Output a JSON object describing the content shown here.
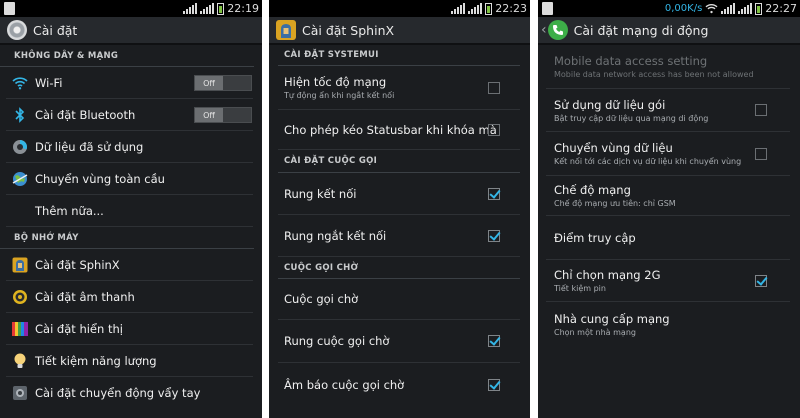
{
  "colors": {
    "accent": "#33b5e5",
    "background": "#1b1d20",
    "battery": "#7fc241"
  },
  "panel1": {
    "status": {
      "time": "22:19"
    },
    "title": "Cài đặt",
    "title_icon": "settings-gear-icon",
    "sections": [
      {
        "header": "KHÔNG DÂY & MẠNG"
      },
      {
        "header": "BỘ NHỚ MÁY"
      }
    ],
    "rows": [
      {
        "label": "Wi-Fi",
        "icon": "wifi-icon",
        "toggle": "Off"
      },
      {
        "label": "Cài đặt Bluetooth",
        "icon": "bluetooth-icon",
        "toggle": "Off"
      },
      {
        "label": "Dữ liệu đã sử dụng",
        "icon": "data-usage-icon"
      },
      {
        "label": "Chuyển vùng toàn cầu",
        "icon": "globe-icon"
      },
      {
        "label": "Thêm nữa..."
      },
      {
        "label": "Cài đặt SphinX",
        "icon": "sphinx-icon"
      },
      {
        "label": "Cài đặt âm thanh",
        "icon": "sound-icon"
      },
      {
        "label": "Cài đặt hiển thị",
        "icon": "display-icon"
      },
      {
        "label": "Tiết kiệm năng lượng",
        "icon": "power-saving-icon"
      },
      {
        "label": "Cài đặt chuyển động vẩy tay",
        "icon": "gesture-icon"
      }
    ]
  },
  "panel2": {
    "status": {
      "time": "22:23"
    },
    "title": "Cài đặt SphinX",
    "title_icon": "sphinx-icon",
    "sections": [
      {
        "header": "CÀI ĐẶT SYSTEMUI"
      },
      {
        "header": "CÀI ĐẶT CUỘC GỌI"
      },
      {
        "header": "CUỘC GỌI CHỜ"
      }
    ],
    "rows": [
      {
        "label": "Hiện tốc độ mạng",
        "sub": "Tự động ẩn khi ngắt kết nối",
        "checked": false
      },
      {
        "label": "Cho phép kéo Statusbar khi khóa mà",
        "checked": false
      },
      {
        "label": "Rung kết nối",
        "checked": true
      },
      {
        "label": "Rung ngắt kết nối",
        "checked": true
      },
      {
        "label": "Cuộc gọi chờ"
      },
      {
        "label": "Rung cuộc gọi chờ",
        "checked": true
      },
      {
        "label": "Âm báo cuộc gọi chờ",
        "checked": true
      }
    ]
  },
  "panel3": {
    "status": {
      "speed": "0,00K/s",
      "time": "22:27"
    },
    "title": "Cài đặt mạng di động",
    "title_icon": "phone-icon",
    "rows": [
      {
        "label": "Mobile data access setting",
        "sub": "Mobile data network access has been not allowed",
        "disabled": true
      },
      {
        "label": "Sử dụng dữ liệu gói",
        "sub": "Bật truy cập dữ liệu qua mạng di động",
        "checked": false
      },
      {
        "label": "Chuyển vùng dữ liệu",
        "sub": "Kết nối tới các dịch vụ dữ liệu khi chuyển vùng",
        "checked": false
      },
      {
        "label": "Chế độ mạng",
        "sub": "Chế độ mạng ưu tiên: chỉ GSM"
      },
      {
        "label": "Điểm truy cập"
      },
      {
        "label": "Chỉ chọn mạng 2G",
        "sub": "Tiết kiệm pin",
        "checked": true
      },
      {
        "label": "Nhà cung cấp mạng",
        "sub": "Chọn một nhà mạng"
      }
    ]
  }
}
